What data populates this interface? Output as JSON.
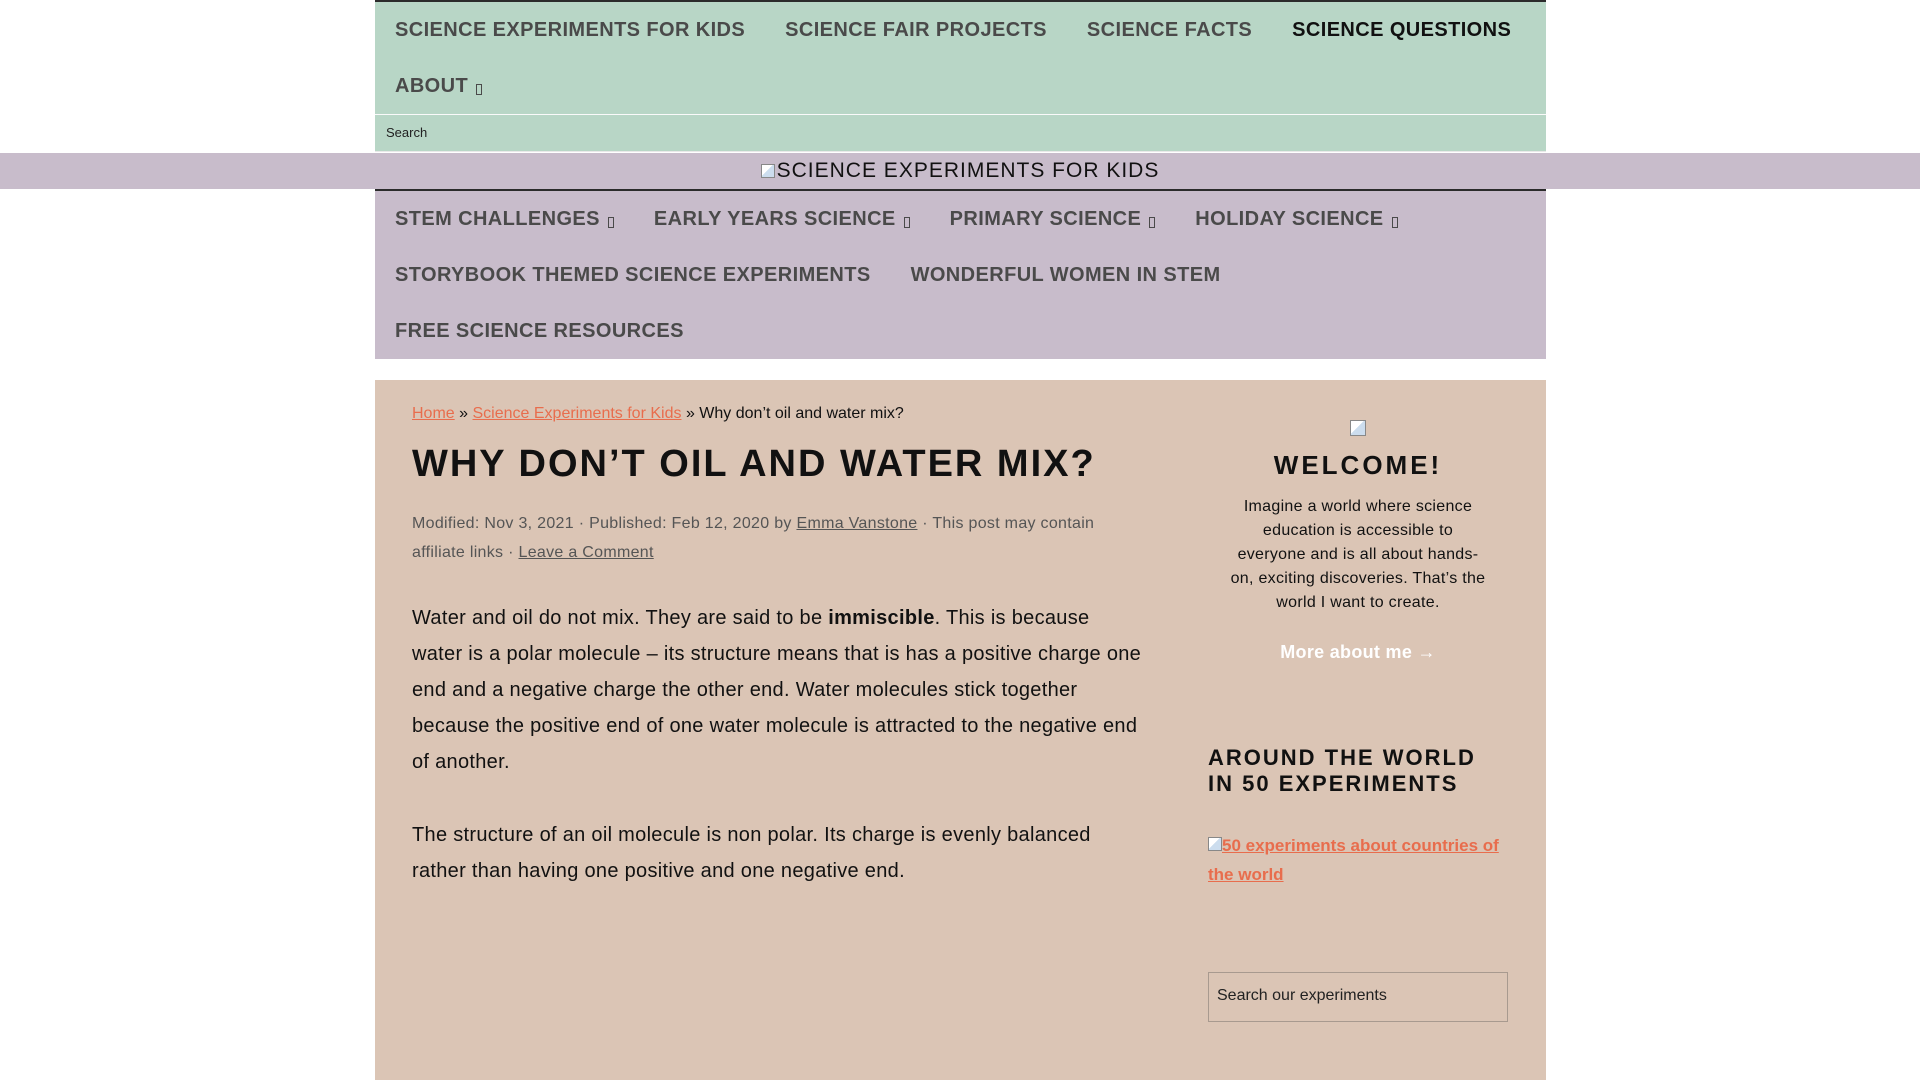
{
  "top_nav": {
    "items": [
      {
        "label": "SCIENCE EXPERIMENTS FOR KIDS"
      },
      {
        "label": "SCIENCE FAIR PROJECTS"
      },
      {
        "label": "SCIENCE FACTS"
      },
      {
        "label": "SCIENCE QUESTIONS",
        "active": true
      },
      {
        "label": "ABOUT",
        "has_submenu": true
      }
    ],
    "search_placeholder": "Search"
  },
  "header": {
    "logo_alt": "SCIENCE EXPERIMENTS FOR KIDS",
    "logo_icon": "broken-image-icon"
  },
  "second_nav": {
    "items": [
      {
        "label": "STEM CHALLENGES",
        "has_submenu": true
      },
      {
        "label": "EARLY YEARS SCIENCE",
        "has_submenu": true
      },
      {
        "label": "PRIMARY SCIENCE",
        "has_submenu": true
      },
      {
        "label": "HOLIDAY SCIENCE",
        "has_submenu": true
      },
      {
        "label": "STORYBOOK THEMED SCIENCE EXPERIMENTS"
      },
      {
        "label": "WONDERFUL WOMEN IN STEM"
      },
      {
        "label": "FREE SCIENCE RESOURCES"
      }
    ]
  },
  "breadcrumb": {
    "home": "Home",
    "sep": "»",
    "category": "Science Experiments for Kids",
    "current": "Why don’t oil and water mix?"
  },
  "article": {
    "title": "WHY DON’T OIL AND WATER MIX?",
    "meta": {
      "modified": "Modified: Nov 3, 2021",
      "published": "Published: Feb 12, 2020",
      "by": "by",
      "author": "Emma Vanstone",
      "affiliate": "This post may contain affiliate links",
      "comment": "Leave a Comment",
      "dot": "·"
    },
    "para1_start": "Water and oil do not mix. They are said to be ",
    "para1_bold": "immiscible",
    "para1_end": ". This is because water is a polar molecule – its structure means that is has a positive charge one end and a negative charge the other end. Water molecules stick together because the positive end of one water molecule is attracted to the negative end of another.",
    "para2": "The structure of an oil molecule is non polar. Its charge is evenly balanced rather than having one positive and one negative end."
  },
  "sidebar": {
    "welcome_title": "WELCOME!",
    "welcome_text": "Imagine a world where science education is accessible to everyone and is all about hands-on, exciting discoveries. That’s the world I want to create.",
    "more_link": "More about me →",
    "widget_title": "AROUND THE WORLD IN 50 EXPERIMENTS",
    "widget_link": "50 experiments about countries of the world",
    "search_placeholder": "Search our experiments"
  },
  "colors": {
    "top_nav_bg": "#b8d6c6",
    "header_band_bg": "#c8bccb",
    "content_bg": "#dbc5b5",
    "link": "#e86d4d"
  }
}
